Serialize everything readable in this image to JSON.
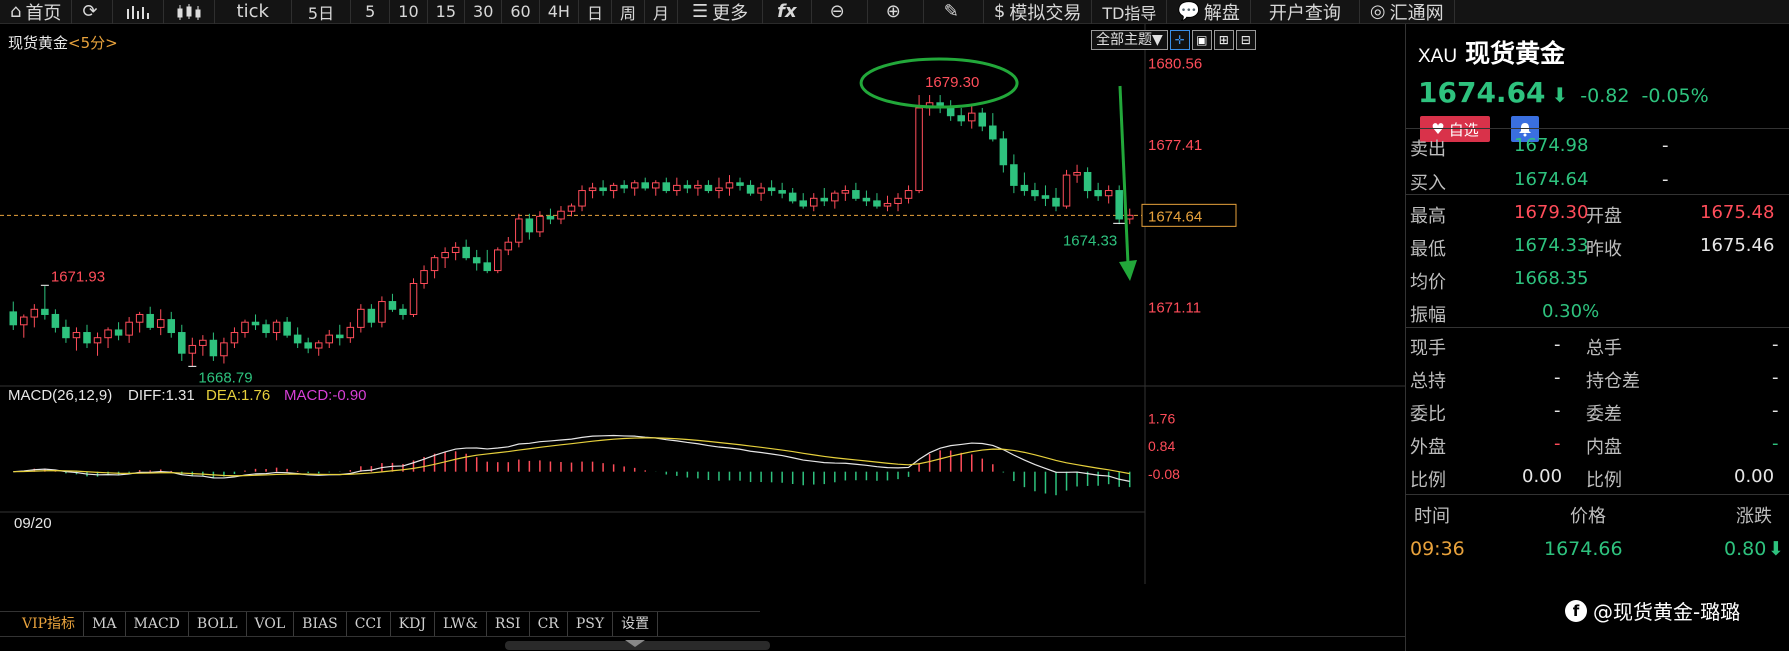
{
  "toolbar": {
    "home": "首页",
    "tick": "tick",
    "periods": [
      "5日",
      "5",
      "10",
      "15",
      "30",
      "60",
      "4H",
      "日",
      "周",
      "月"
    ],
    "more": "更多",
    "fx": "fx",
    "sim_trade": "模拟交易",
    "td_guide": "TD指导",
    "analysis": "解盘",
    "account": "开户查询",
    "huitong": "汇通网"
  },
  "chart": {
    "title": "现货黄金",
    "period": "<5分>",
    "theme_button": "全部主题▼",
    "date_label": "09/20",
    "price_axis": [
      "1680.56",
      "1677.41",
      "1671.11"
    ],
    "current_price_tag": "1674.64",
    "annotations": {
      "high": "1679.30",
      "left_high": "1671.93",
      "left_low": "1668.79",
      "last_low": "1674.33"
    },
    "macd_legend": {
      "name": "MACD(26,12,9)",
      "diff": "DIFF:1.31",
      "dea": "DEA:1.76",
      "macd": "MACD:-0.90"
    },
    "macd_axis": [
      "1.76",
      "0.84",
      "-0.08"
    ],
    "colors": {
      "up": "#ff4d5a",
      "down": "#2ec27e",
      "diff": "#e6e6e6",
      "dea": "#e6d03c",
      "macd_label": "#d63fd6",
      "dashed": "#e8a23c",
      "circle": "#22a83a"
    }
  },
  "chart_data": {
    "type": "candlestick",
    "title": "现货黄金",
    "period": "5分",
    "ylim": [
      1668.3,
      1681.2
    ],
    "candles": [
      [
        1670.9,
        1671.3,
        1670.2,
        1670.4
      ],
      [
        1670.4,
        1670.8,
        1669.9,
        1670.7
      ],
      [
        1670.7,
        1671.2,
        1670.3,
        1671.0
      ],
      [
        1671.0,
        1671.9,
        1670.6,
        1670.8
      ],
      [
        1670.8,
        1671.0,
        1670.1,
        1670.3
      ],
      [
        1670.3,
        1670.6,
        1669.7,
        1669.9
      ],
      [
        1669.9,
        1670.3,
        1669.4,
        1670.1
      ],
      [
        1670.1,
        1670.4,
        1669.5,
        1669.7
      ],
      [
        1669.7,
        1670.1,
        1669.2,
        1669.9
      ],
      [
        1669.9,
        1670.3,
        1669.5,
        1670.2
      ],
      [
        1670.2,
        1670.5,
        1669.8,
        1670.0
      ],
      [
        1670.0,
        1670.7,
        1669.7,
        1670.5
      ],
      [
        1670.5,
        1670.9,
        1670.1,
        1670.8
      ],
      [
        1670.8,
        1671.1,
        1670.2,
        1670.3
      ],
      [
        1670.3,
        1671.0,
        1670.0,
        1670.6
      ],
      [
        1670.6,
        1670.9,
        1669.9,
        1670.1
      ],
      [
        1670.1,
        1670.4,
        1669.0,
        1669.3
      ],
      [
        1669.3,
        1669.9,
        1668.8,
        1669.6
      ],
      [
        1669.6,
        1670.0,
        1669.2,
        1669.8
      ],
      [
        1669.8,
        1670.1,
        1669.0,
        1669.2
      ],
      [
        1669.2,
        1669.9,
        1668.9,
        1669.7
      ],
      [
        1669.7,
        1670.3,
        1669.5,
        1670.1
      ],
      [
        1670.1,
        1670.6,
        1669.9,
        1670.5
      ],
      [
        1670.5,
        1670.8,
        1670.2,
        1670.4
      ],
      [
        1670.4,
        1670.6,
        1669.9,
        1670.1
      ],
      [
        1670.1,
        1670.6,
        1669.8,
        1670.5
      ],
      [
        1670.5,
        1670.7,
        1669.9,
        1670.0
      ],
      [
        1670.0,
        1670.3,
        1669.5,
        1669.7
      ],
      [
        1669.7,
        1669.9,
        1669.3,
        1669.5
      ],
      [
        1669.5,
        1669.8,
        1669.2,
        1669.7
      ],
      [
        1669.7,
        1670.2,
        1669.5,
        1670.0
      ],
      [
        1670.0,
        1670.4,
        1669.6,
        1669.9
      ],
      [
        1669.9,
        1670.5,
        1669.7,
        1670.3
      ],
      [
        1670.3,
        1671.2,
        1670.1,
        1671.0
      ],
      [
        1671.0,
        1671.2,
        1670.3,
        1670.5
      ],
      [
        1670.5,
        1671.5,
        1670.3,
        1671.3
      ],
      [
        1671.3,
        1671.6,
        1670.9,
        1671.0
      ],
      [
        1671.0,
        1671.2,
        1670.6,
        1670.8
      ],
      [
        1670.8,
        1672.2,
        1670.7,
        1672.0
      ],
      [
        1672.0,
        1672.7,
        1671.8,
        1672.5
      ],
      [
        1672.5,
        1673.1,
        1672.2,
        1673.0
      ],
      [
        1673.0,
        1673.4,
        1672.6,
        1673.2
      ],
      [
        1673.2,
        1673.6,
        1672.9,
        1673.4
      ],
      [
        1673.4,
        1673.7,
        1672.9,
        1673.0
      ],
      [
        1673.0,
        1673.3,
        1672.5,
        1672.8
      ],
      [
        1672.8,
        1673.3,
        1672.4,
        1672.5
      ],
      [
        1672.5,
        1673.4,
        1672.4,
        1673.3
      ],
      [
        1673.3,
        1673.8,
        1673.1,
        1673.6
      ],
      [
        1673.6,
        1674.7,
        1673.4,
        1674.5
      ],
      [
        1674.5,
        1674.7,
        1673.7,
        1674.0
      ],
      [
        1674.0,
        1674.8,
        1673.8,
        1674.6
      ],
      [
        1674.6,
        1674.9,
        1674.3,
        1674.5
      ],
      [
        1674.5,
        1675.0,
        1674.3,
        1674.8
      ],
      [
        1674.8,
        1675.1,
        1674.6,
        1675.0
      ],
      [
        1675.0,
        1675.8,
        1674.8,
        1675.6
      ],
      [
        1675.6,
        1675.9,
        1675.3,
        1675.7
      ],
      [
        1675.7,
        1676.0,
        1675.4,
        1675.6
      ],
      [
        1675.6,
        1675.9,
        1675.3,
        1675.8
      ],
      [
        1675.8,
        1676.0,
        1675.5,
        1675.7
      ],
      [
        1675.7,
        1676.0,
        1675.4,
        1675.9
      ],
      [
        1675.9,
        1676.1,
        1675.6,
        1675.7
      ],
      [
        1675.7,
        1676.0,
        1675.4,
        1675.9
      ],
      [
        1675.9,
        1676.1,
        1675.5,
        1675.6
      ],
      [
        1675.6,
        1676.1,
        1675.4,
        1675.8
      ],
      [
        1675.8,
        1676.0,
        1675.5,
        1675.7
      ],
      [
        1675.7,
        1676.0,
        1675.4,
        1675.8
      ],
      [
        1675.8,
        1676.0,
        1675.5,
        1675.6
      ],
      [
        1675.6,
        1676.1,
        1675.3,
        1675.7
      ],
      [
        1675.7,
        1676.2,
        1675.4,
        1675.9
      ],
      [
        1675.9,
        1676.1,
        1675.6,
        1675.8
      ],
      [
        1675.8,
        1676.0,
        1675.4,
        1675.5
      ],
      [
        1675.5,
        1675.9,
        1675.2,
        1675.7
      ],
      [
        1675.7,
        1676.0,
        1675.4,
        1675.6
      ],
      [
        1675.6,
        1675.9,
        1675.3,
        1675.5
      ],
      [
        1675.5,
        1675.7,
        1675.1,
        1675.2
      ],
      [
        1675.2,
        1675.5,
        1674.9,
        1675.0
      ],
      [
        1675.0,
        1675.5,
        1674.8,
        1675.3
      ],
      [
        1675.3,
        1675.7,
        1675.0,
        1675.2
      ],
      [
        1675.2,
        1675.6,
        1674.9,
        1675.5
      ],
      [
        1675.5,
        1675.8,
        1675.2,
        1675.6
      ],
      [
        1675.6,
        1675.9,
        1675.2,
        1675.3
      ],
      [
        1675.3,
        1675.6,
        1675.0,
        1675.2
      ],
      [
        1675.2,
        1675.5,
        1674.9,
        1675.0
      ],
      [
        1675.0,
        1675.4,
        1674.8,
        1675.1
      ],
      [
        1675.1,
        1675.5,
        1674.8,
        1675.3
      ],
      [
        1675.3,
        1675.8,
        1675.1,
        1675.6
      ],
      [
        1675.6,
        1679.3,
        1675.5,
        1678.8
      ],
      [
        1678.8,
        1679.3,
        1678.5,
        1679.0
      ],
      [
        1679.0,
        1679.3,
        1678.6,
        1678.8
      ],
      [
        1678.8,
        1679.1,
        1678.3,
        1678.5
      ],
      [
        1678.5,
        1678.8,
        1678.1,
        1678.3
      ],
      [
        1678.3,
        1678.9,
        1678.0,
        1678.6
      ],
      [
        1678.6,
        1678.8,
        1677.9,
        1678.1
      ],
      [
        1678.1,
        1678.6,
        1677.5,
        1677.6
      ],
      [
        1677.6,
        1677.9,
        1676.3,
        1676.6
      ],
      [
        1676.6,
        1677.0,
        1675.5,
        1675.8
      ],
      [
        1675.8,
        1676.3,
        1675.4,
        1675.6
      ],
      [
        1675.6,
        1675.9,
        1675.2,
        1675.4
      ],
      [
        1675.4,
        1675.8,
        1675.0,
        1675.3
      ],
      [
        1675.3,
        1675.7,
        1674.8,
        1675.0
      ],
      [
        1675.0,
        1676.4,
        1674.9,
        1676.2
      ],
      [
        1676.2,
        1676.6,
        1675.9,
        1676.3
      ],
      [
        1676.3,
        1676.5,
        1675.3,
        1675.6
      ],
      [
        1675.6,
        1675.9,
        1675.2,
        1675.4
      ],
      [
        1675.4,
        1675.8,
        1675.1,
        1675.6
      ],
      [
        1675.6,
        1675.8,
        1674.3,
        1674.5
      ],
      [
        1674.5,
        1674.9,
        1674.3,
        1674.64
      ]
    ]
  },
  "indicators": [
    "VIP指标",
    "MA",
    "MACD",
    "BOLL",
    "VOL",
    "BIAS",
    "CCI",
    "KDJ",
    "LW&",
    "RSI",
    "CR",
    "PSY",
    "设置"
  ],
  "quote": {
    "code": "XAU",
    "name": "现货黄金",
    "last": "1674.64",
    "arrow": "⬇",
    "change": "-0.82",
    "change_pct": "-0.05%",
    "fav": "自选",
    "sell_label": "卖出",
    "sell": "1674.98",
    "sell_vol": "-",
    "buy_label": "买入",
    "buy": "1674.64",
    "buy_vol": "-",
    "high_label": "最高",
    "high": "1679.30",
    "open_label": "开盘",
    "open": "1675.48",
    "low_label": "最低",
    "low": "1674.33",
    "prev_label": "昨收",
    "prev_close": "1675.46",
    "avg_label": "均价",
    "avg": "1668.35",
    "amp_label": "振幅",
    "amplitude": "0.30%",
    "cur_hand_label": "现手",
    "cur_hand": "-",
    "total_hand_label": "总手",
    "total_hand": "-",
    "total_hold_label": "总持",
    "total_hold": "-",
    "pos_diff_label": "持仓差",
    "pos_diff": "-",
    "wei_bi_label": "委比",
    "wei_bi": "-",
    "wei_cha_label": "委差",
    "wei_cha": "-",
    "out_label": "外盘",
    "out_vol": "-",
    "in_label": "内盘",
    "in_vol": "-",
    "ratio_label": "比例",
    "ratio1": "0.00",
    "ratio2_label": "比例",
    "ratio2": "0.00",
    "ticks_head": {
      "time": "时间",
      "price": "价格",
      "change": "涨跌"
    },
    "tick": {
      "time": "09:36",
      "price": "1674.66",
      "change": "0.80",
      "arrow": "⬇"
    }
  },
  "watermark": "@现货黄金-璐璐"
}
